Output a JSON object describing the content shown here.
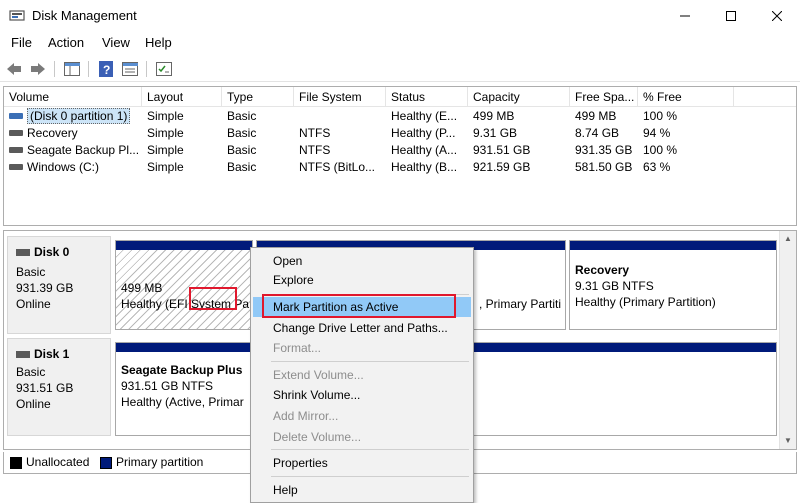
{
  "window": {
    "title": "Disk Management"
  },
  "menu": [
    "File",
    "Action",
    "View",
    "Help"
  ],
  "columns": [
    "Volume",
    "Layout",
    "Type",
    "File System",
    "Status",
    "Capacity",
    "Free Spa...",
    "% Free"
  ],
  "volumes": [
    {
      "volume": "(Disk 0 partition 1)",
      "layout": "Simple",
      "type": "Basic",
      "fs": "",
      "status": "Healthy (E...",
      "capacity": "499 MB",
      "free": "499 MB",
      "pct": "100 %"
    },
    {
      "volume": "Recovery",
      "layout": "Simple",
      "type": "Basic",
      "fs": "NTFS",
      "status": "Healthy (P...",
      "capacity": "9.31 GB",
      "free": "8.74 GB",
      "pct": "94 %"
    },
    {
      "volume": "Seagate Backup Pl...",
      "layout": "Simple",
      "type": "Basic",
      "fs": "NTFS",
      "status": "Healthy (A...",
      "capacity": "931.51 GB",
      "free": "931.35 GB",
      "pct": "100 %"
    },
    {
      "volume": "Windows (C:)",
      "layout": "Simple",
      "type": "Basic",
      "fs": "NTFS (BitLo...",
      "status": "Healthy (B...",
      "capacity": "921.59 GB",
      "free": "581.50 GB",
      "pct": "63 %"
    }
  ],
  "disks": [
    {
      "name": "Disk 0",
      "type": "Basic",
      "size": "931.39 GB",
      "state": "Online",
      "partitions": [
        {
          "line1": "499 MB",
          "line2": "Healthy (EFI System Pa"
        },
        {
          "line1": "",
          "line2": ", Primary Partiti"
        },
        {
          "title": "Recovery",
          "line1": "9.31 GB NTFS",
          "line2": "Healthy (Primary Partition)"
        }
      ]
    },
    {
      "name": "Disk 1",
      "type": "Basic",
      "size": "931.51 GB",
      "state": "Online",
      "partitions": [
        {
          "title": "Seagate Backup Plus",
          "line1": "931.51 GB NTFS",
          "line2": "Healthy (Active, Primar"
        }
      ]
    }
  ],
  "legend": [
    {
      "label": "Unallocated",
      "color": "#000000"
    },
    {
      "label": "Primary partition",
      "color": "#001a7a"
    }
  ],
  "context_menu": [
    {
      "label": "Open",
      "enabled": true
    },
    {
      "label": "Explore",
      "enabled": true
    },
    {
      "label": "Mark Partition as Active",
      "enabled": true,
      "highlighted": true
    },
    {
      "label": "Change Drive Letter and Paths...",
      "enabled": true
    },
    {
      "label": "Format...",
      "enabled": false
    },
    {
      "label": "Extend Volume...",
      "enabled": false
    },
    {
      "label": "Shrink Volume...",
      "enabled": true
    },
    {
      "label": "Add Mirror...",
      "enabled": false
    },
    {
      "label": "Delete Volume...",
      "enabled": false
    },
    {
      "label": "Properties",
      "enabled": true
    },
    {
      "label": "Help",
      "enabled": true
    }
  ],
  "colors": {
    "highlight": "#91c9f7",
    "annotation": "#e0182d",
    "partition_bar": "#001a7a"
  }
}
